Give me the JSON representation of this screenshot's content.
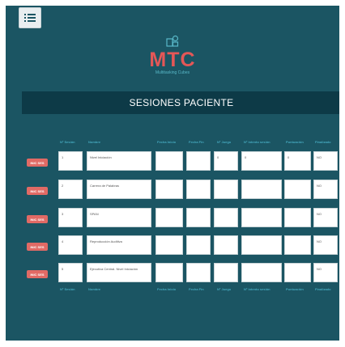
{
  "app": {
    "menu_icon": "list-icon",
    "logo_icon": "cubes-outline-icon",
    "logo_title": "MTC",
    "logo_subtitle": "Multitasking Cubes"
  },
  "header": {
    "title": "SESIONES PACIENTE"
  },
  "colors": {
    "background": "#1b5563",
    "header_bar": "#0d3a47",
    "accent_red": "#e16a65",
    "column_header": "#46a9bf"
  },
  "table": {
    "columns": [
      "Nº Sesión",
      "Nombre",
      "Fecha Inicio",
      "Fecha Fin",
      "Nº Juego",
      "Nº intento sesión",
      "Puntuación",
      "Finalizado"
    ],
    "button_label": "INIC SES",
    "rows": [
      {
        "sesion": "1",
        "nombre": "Nivel Iniciación",
        "fecha_inicio": "",
        "fecha_fin": "",
        "juego": "0",
        "intento": "0",
        "puntuacion": "0",
        "finalizado": "NO"
      },
      {
        "sesion": "2",
        "nombre": "Carrera de Palabras",
        "fecha_inicio": "",
        "fecha_fin": "",
        "juego": "",
        "intento": "",
        "puntuacion": "",
        "finalizado": "NO"
      },
      {
        "sesion": "3",
        "nombre": "SPAN",
        "fecha_inicio": "",
        "fecha_fin": "",
        "juego": "",
        "intento": "",
        "puntuacion": "",
        "finalizado": "NO"
      },
      {
        "sesion": "4",
        "nombre": "Reproducción Auditiva",
        "fecha_inicio": "",
        "fecha_fin": "",
        "juego": "",
        "intento": "",
        "puntuacion": "",
        "finalizado": "NO"
      },
      {
        "sesion": "5",
        "nombre": "Ejecutiva Central. Nivel Iniciación",
        "fecha_inicio": "",
        "fecha_fin": "",
        "juego": "",
        "intento": "",
        "puntuacion": "",
        "finalizado": "NO"
      }
    ]
  }
}
